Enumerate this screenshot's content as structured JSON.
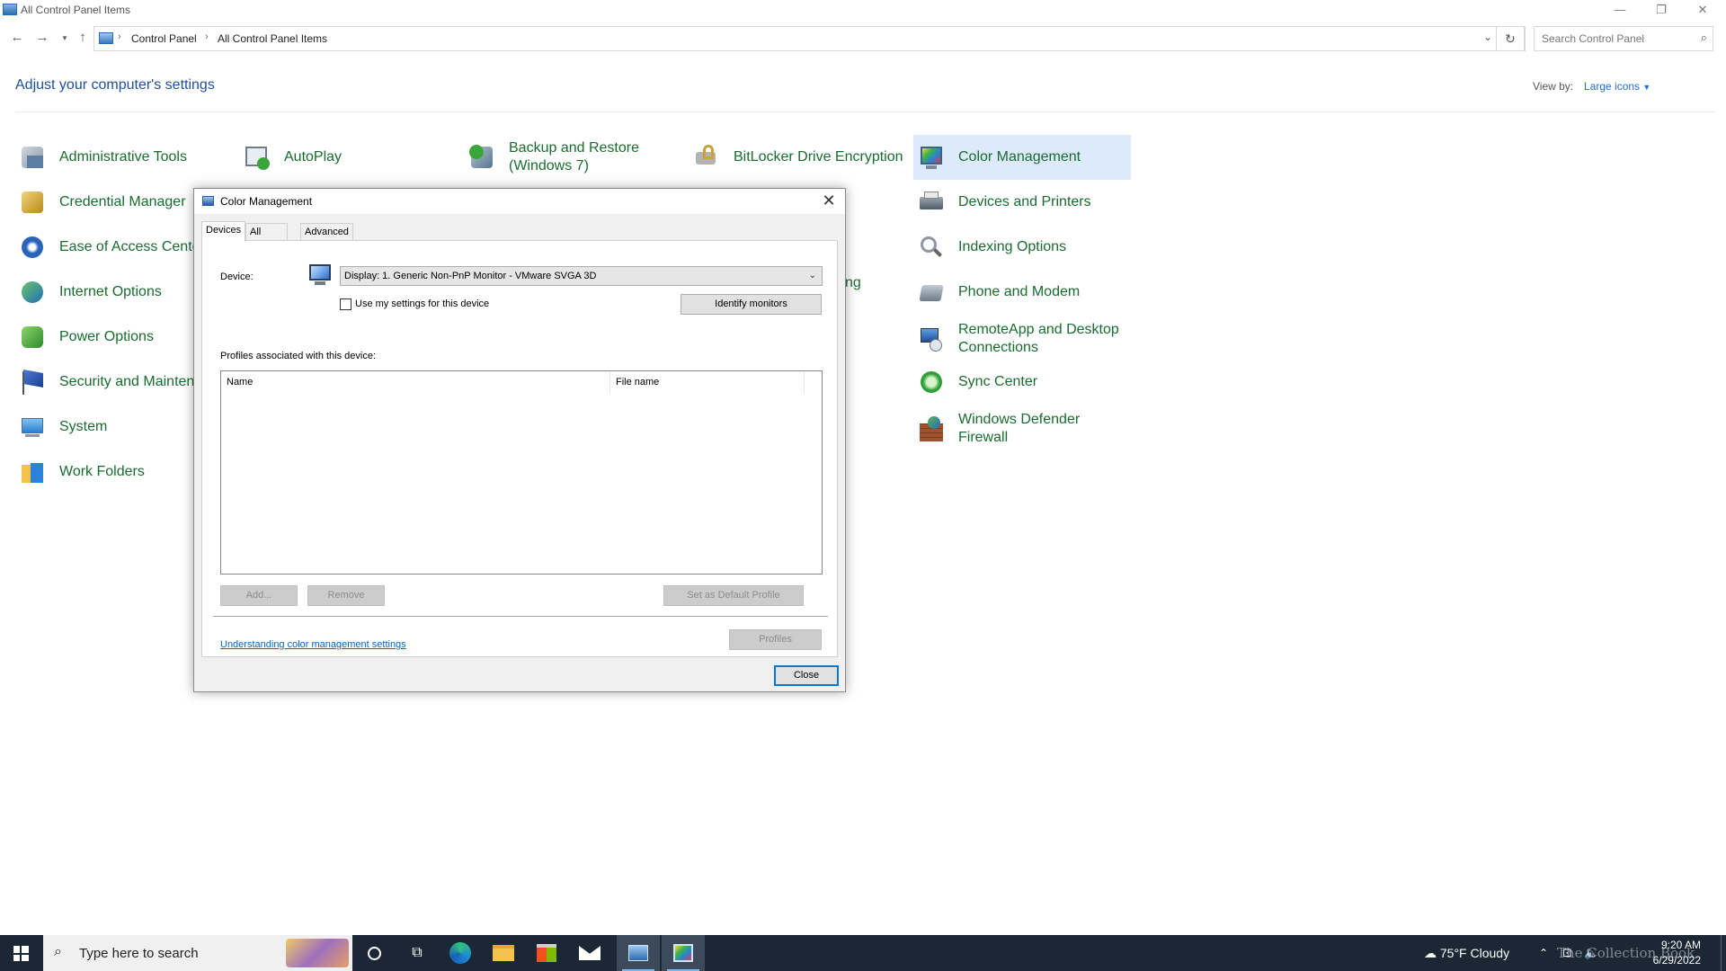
{
  "window": {
    "title": "All Control Panel Items",
    "minimize_icon": "minimize-icon",
    "maximize_icon": "restore-icon",
    "close_icon": "close-icon"
  },
  "address_bar": {
    "crumbs": [
      "Control Panel",
      "All Control Panel Items"
    ],
    "search_placeholder": "Search Control Panel"
  },
  "header": {
    "title": "Adjust your computer's settings",
    "view_by_label": "View by:",
    "view_by_value": "Large icons"
  },
  "items": [
    {
      "label": "Administrative Tools",
      "icon": "admin-tools-icon"
    },
    {
      "label": "AutoPlay",
      "icon": "autoplay-icon"
    },
    {
      "label": "Backup and Restore (Windows 7)",
      "label_line1": "Backup and Restore",
      "label_line2": "(Windows 7)",
      "icon": "backup-icon"
    },
    {
      "label": "BitLocker Drive Encryption",
      "icon": "bitlocker-icon"
    },
    {
      "label": "Color Management",
      "icon": "color-management-icon"
    },
    {
      "label": "Credential Manager",
      "icon": "credential-manager-icon"
    },
    {
      "label": "Devices and Printers",
      "icon": "devices-printers-icon"
    },
    {
      "label": "Ease of Access Center",
      "icon": "ease-of-access-icon"
    },
    {
      "label": "Indexing Options",
      "icon": "indexing-icon"
    },
    {
      "label": "Internet Options",
      "icon": "internet-options-icon"
    },
    {
      "label": "Phone and Modem",
      "icon": "phone-modem-icon"
    },
    {
      "label": "Power Options",
      "icon": "power-options-icon"
    },
    {
      "label": "RemoteApp and Desktop Connections",
      "label_line1": "RemoteApp and Desktop",
      "label_line2": "Connections",
      "icon": "remoteapp-icon"
    },
    {
      "label": "Security and Maintena",
      "icon": "security-flag-icon"
    },
    {
      "label": "Sync Center",
      "icon": "sync-center-icon"
    },
    {
      "label": "System",
      "icon": "system-icon"
    },
    {
      "label": "Windows Defender Firewall",
      "label_line1": "Windows Defender",
      "label_line2": "Firewall",
      "icon": "firewall-icon"
    },
    {
      "label": "Work Folders",
      "icon": "work-folders-icon"
    },
    {
      "label": "ng",
      "icon": ""
    }
  ],
  "dialog": {
    "title": "Color Management",
    "tabs": [
      "Devices",
      "All Profiles",
      "Advanced"
    ],
    "device_label": "Device:",
    "device_value": "Display: 1. Generic Non-PnP Monitor - VMware SVGA 3D",
    "use_settings_label": "Use my settings for this device",
    "use_settings_checked": false,
    "identify_button": "Identify monitors",
    "profiles_label": "Profiles associated with this device:",
    "columns": [
      "Name",
      "File name"
    ],
    "rows": [],
    "add_button": "Add...",
    "remove_button": "Remove",
    "default_button": "Set as Default Profile",
    "profiles_button": "Profiles",
    "help_link": "Understanding color management settings",
    "close_button": "Close"
  },
  "taskbar": {
    "search_placeholder": "Type here to search",
    "weather": "75°F  Cloudy",
    "time": "9:20 AM",
    "date": "6/29/2022",
    "watermark": "The Collection Book"
  },
  "colors": {
    "link_blue": "#1e4f9c",
    "item_green": "#1a6b30",
    "selection": "#ddeafb",
    "taskbar": "#1c2735"
  }
}
